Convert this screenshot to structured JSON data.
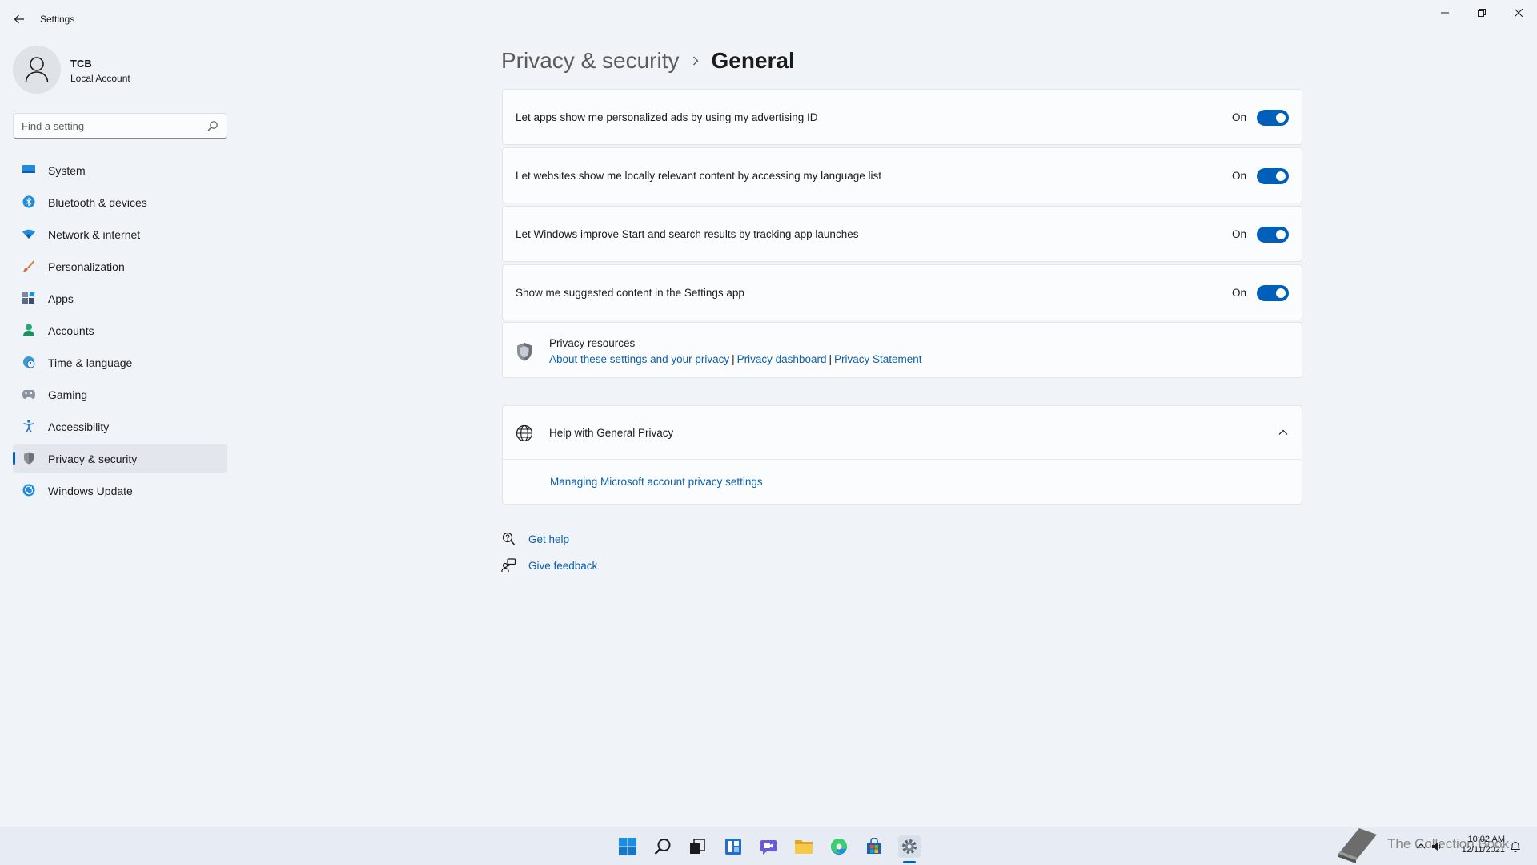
{
  "window": {
    "title": "Settings"
  },
  "profile": {
    "name": "TCB",
    "account_type": "Local Account"
  },
  "search": {
    "placeholder": "Find a setting"
  },
  "sidebar": {
    "items": [
      {
        "label": "System",
        "icon": "monitor-icon"
      },
      {
        "label": "Bluetooth & devices",
        "icon": "bluetooth-icon"
      },
      {
        "label": "Network & internet",
        "icon": "wifi-icon"
      },
      {
        "label": "Personalization",
        "icon": "brush-icon"
      },
      {
        "label": "Apps",
        "icon": "apps-icon"
      },
      {
        "label": "Accounts",
        "icon": "person-icon"
      },
      {
        "label": "Time & language",
        "icon": "globe-clock-icon"
      },
      {
        "label": "Gaming",
        "icon": "gamepad-icon"
      },
      {
        "label": "Accessibility",
        "icon": "accessibility-icon"
      },
      {
        "label": "Privacy & security",
        "icon": "shield-icon",
        "active": true
      },
      {
        "label": "Windows Update",
        "icon": "update-icon"
      }
    ]
  },
  "breadcrumb": {
    "parent": "Privacy & security",
    "current": "General"
  },
  "settings": [
    {
      "label": "Let apps show me personalized ads by using my advertising ID",
      "state": "On"
    },
    {
      "label": "Let websites show me locally relevant content by accessing my language list",
      "state": "On"
    },
    {
      "label": "Let Windows improve Start and search results by tracking app launches",
      "state": "On"
    },
    {
      "label": "Show me suggested content in the Settings app",
      "state": "On"
    }
  ],
  "resources": {
    "title": "Privacy resources",
    "separator": "|",
    "links": [
      "About these settings and your privacy",
      "Privacy dashboard",
      "Privacy Statement"
    ]
  },
  "help": {
    "title": "Help with General Privacy",
    "link": "Managing Microsoft account privacy settings"
  },
  "footer": {
    "get_help": "Get help",
    "give_feedback": "Give feedback"
  },
  "taskbar": {
    "icons": [
      "windows-start-icon",
      "search-icon",
      "task-view-icon",
      "widgets-icon",
      "chat-icon",
      "file-explorer-icon",
      "edge-icon",
      "store-icon",
      "settings-gear-icon"
    ],
    "watermark": "The Collection Book",
    "time": "10:02 AM",
    "date": "12/11/2021"
  },
  "colors": {
    "accent": "#005fb8",
    "link": "#0b5fad",
    "background": "#f0f4f9",
    "card": "#fbfcfd"
  }
}
